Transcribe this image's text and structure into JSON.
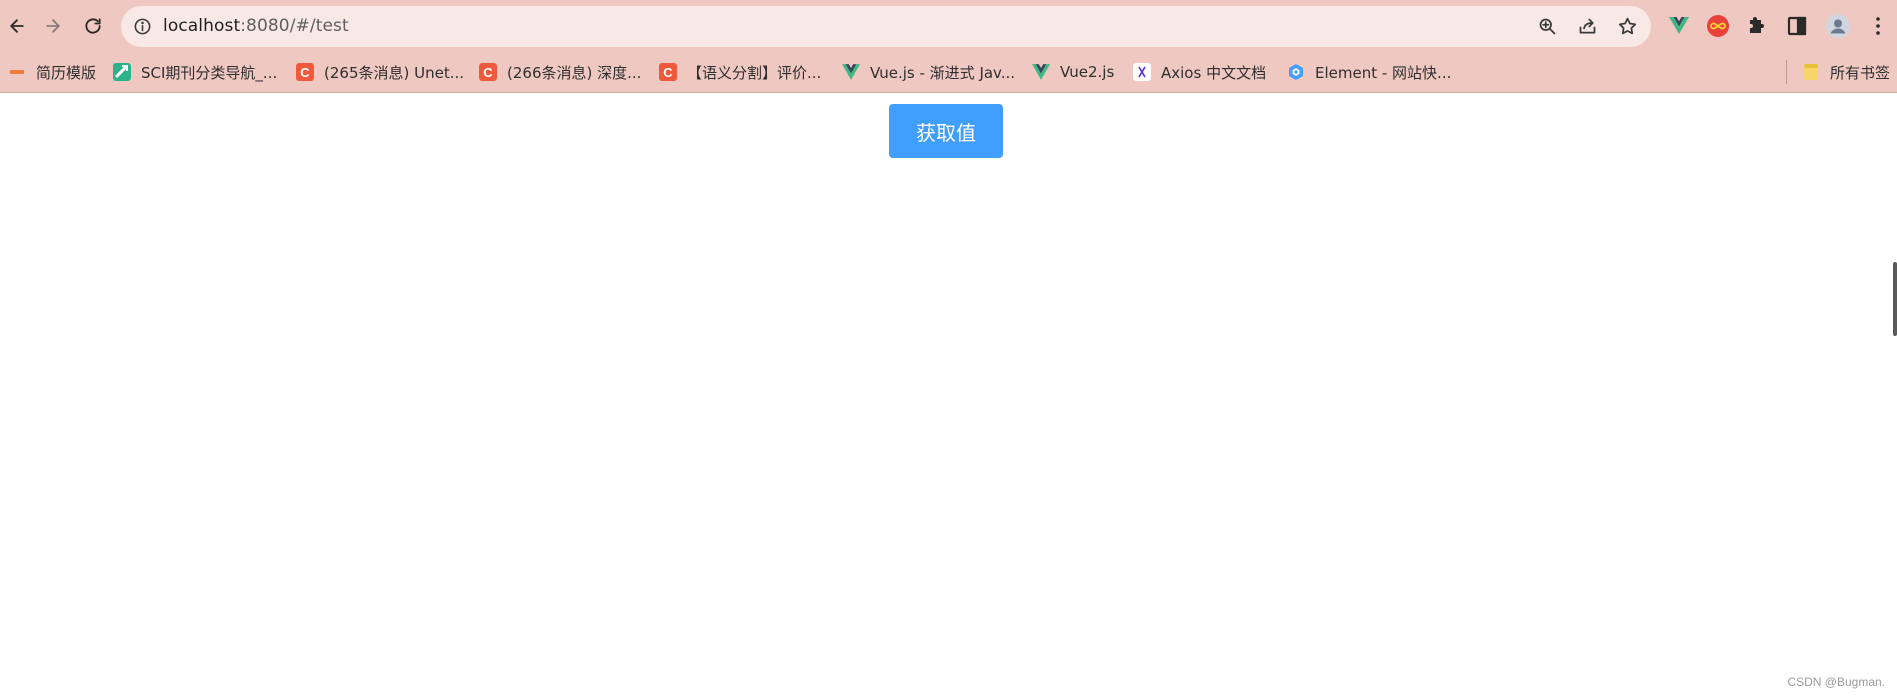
{
  "browser": {
    "url_host": "localhost",
    "url_path": ":8080/#/test"
  },
  "bookmarks": [
    {
      "label": "简历模版",
      "icon": "dash-icon"
    },
    {
      "label": "SCI期刊分类导航_...",
      "icon": "sci-icon"
    },
    {
      "label": "(265条消息) Unet...",
      "icon": "csdn-icon"
    },
    {
      "label": "(266条消息) 深度...",
      "icon": "csdn-icon"
    },
    {
      "label": "【语义分割】评价...",
      "icon": "csdn-icon"
    },
    {
      "label": "Vue.js - 渐进式 Jav...",
      "icon": "vue-icon"
    },
    {
      "label": "Vue2.js",
      "icon": "vue-icon"
    },
    {
      "label": "Axios 中文文档",
      "icon": "axios-icon"
    },
    {
      "label": "Element - 网站快...",
      "icon": "element-icon"
    },
    {
      "label": "所有书签",
      "icon": "folder-icon"
    }
  ],
  "page": {
    "button_label": "获取值",
    "watermark": "CSDN @Bugman."
  },
  "colors": {
    "toolbar_bg": "#f0c8c2",
    "omnibox_bg": "#f8e8e6",
    "primary": "#409eff",
    "csdn": "#f05a3c",
    "vue_green": "#41b883",
    "vue_dark": "#35495e"
  }
}
